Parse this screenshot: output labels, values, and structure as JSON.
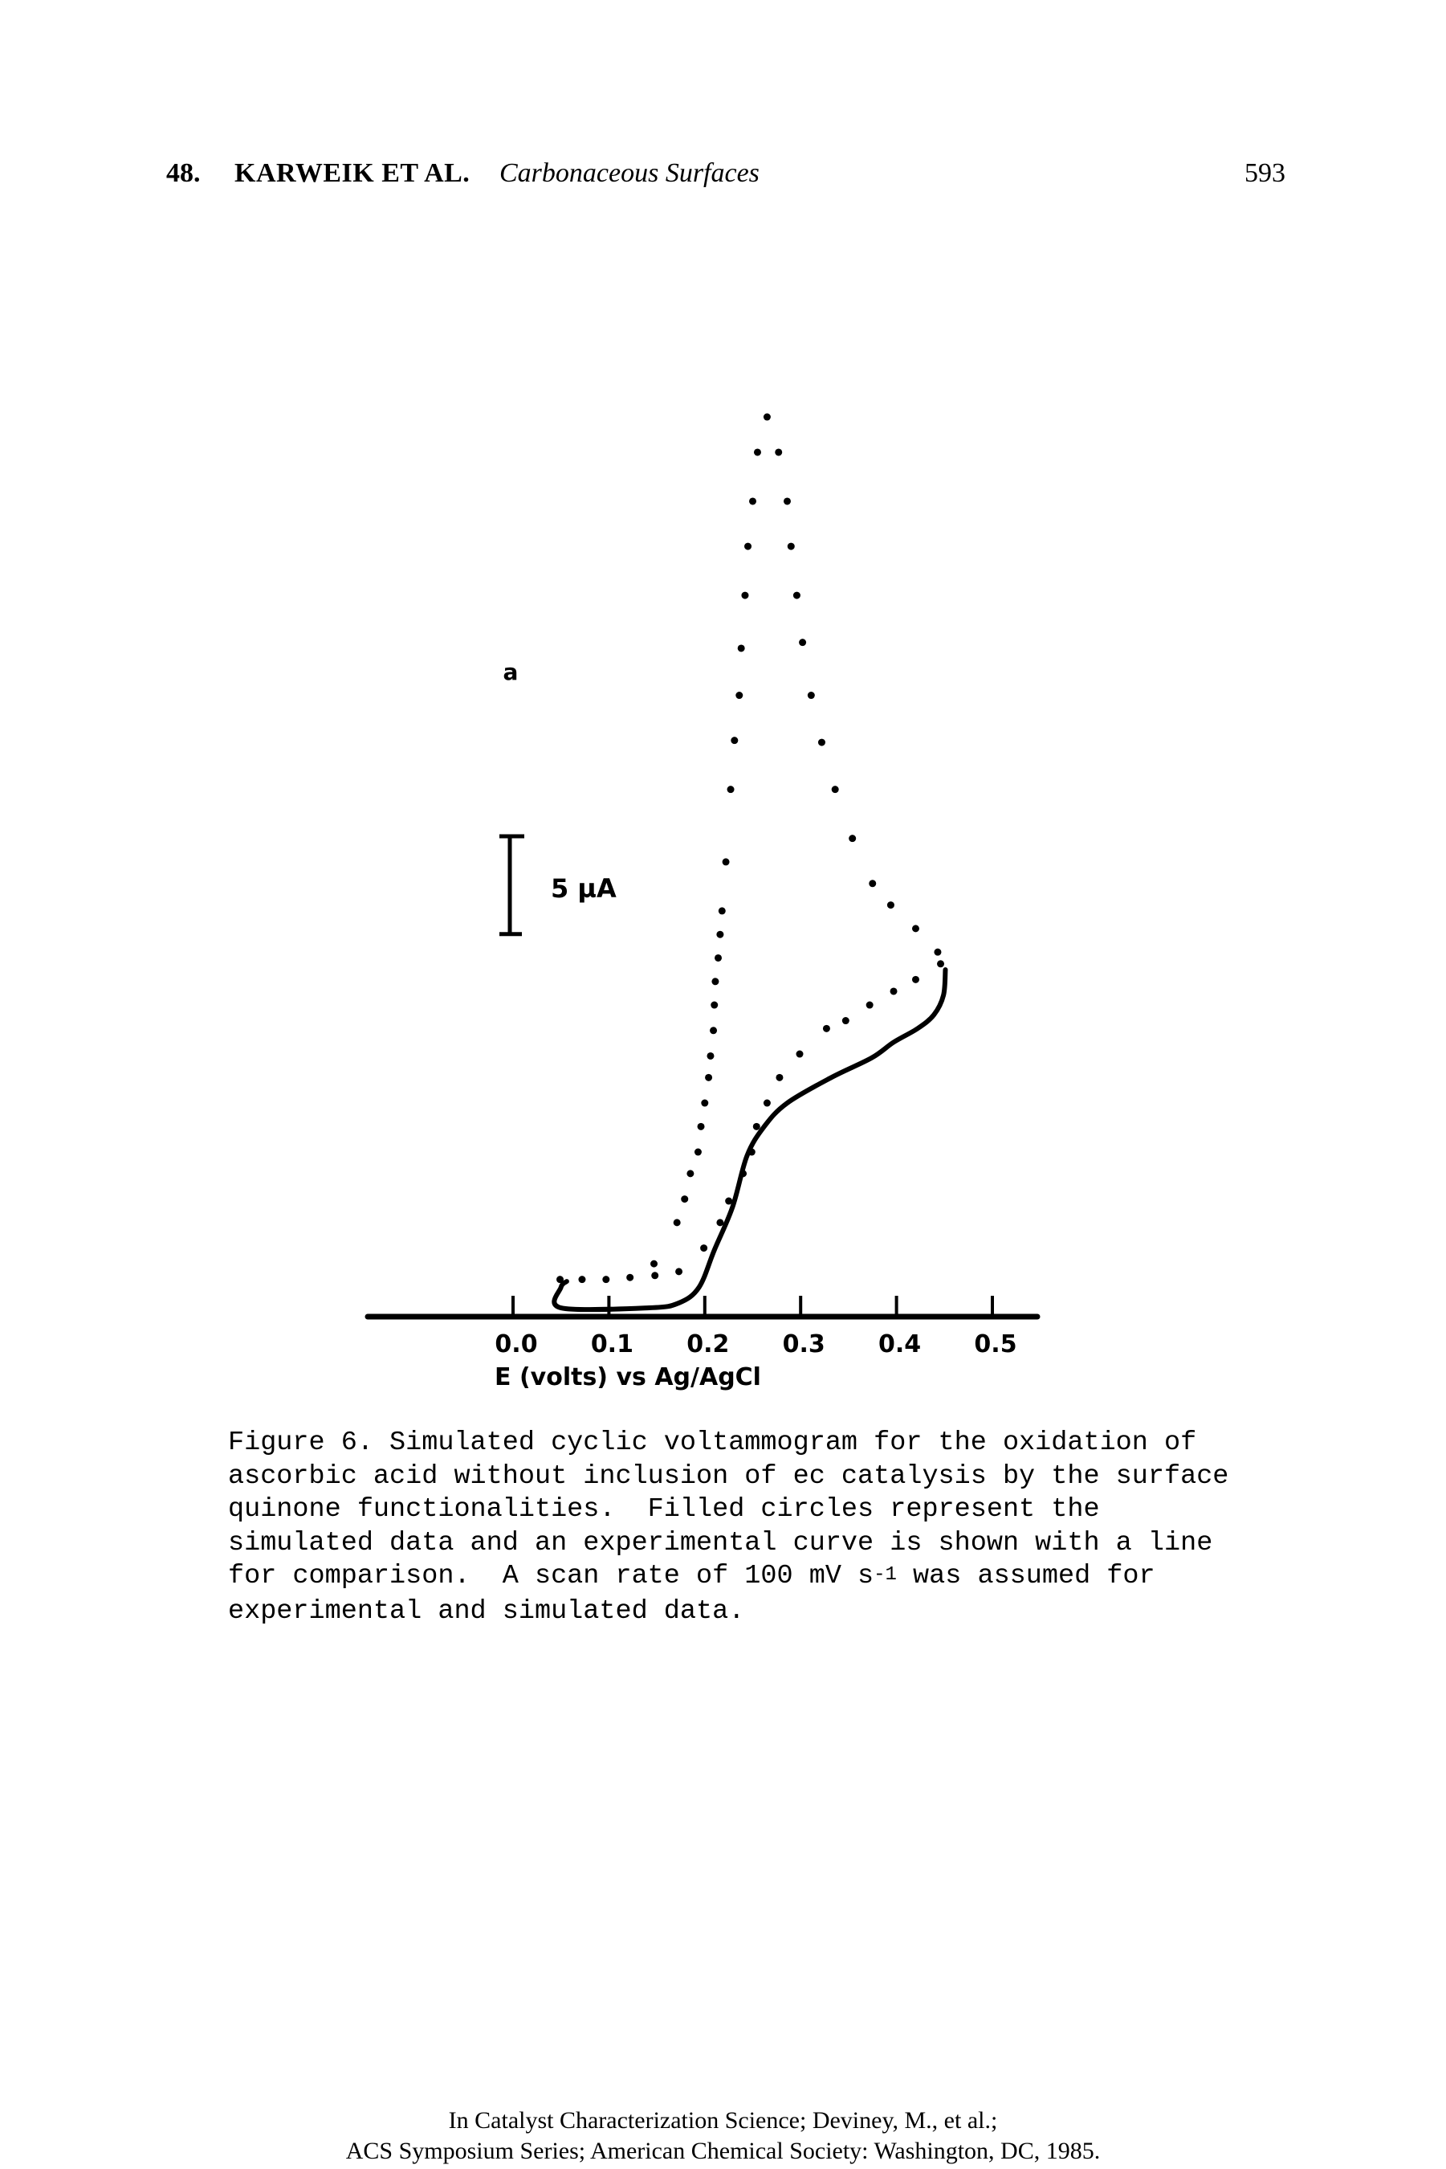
{
  "header": {
    "chapter_number": "48.",
    "authors": "KARWEIK ET AL.",
    "running_title": "Carbonaceous Surfaces",
    "page_number": "593"
  },
  "chart_data": {
    "type": "line",
    "panel_label": "a",
    "scale_bar_label": "5 µA",
    "scale_bar_value_uA": 5,
    "xlabel": "E (volts) vs Ag/AgCl",
    "ylabel": "",
    "xlim": [
      -0.15,
      0.55
    ],
    "ylim": [
      0,
      46
    ],
    "x_ticks": [
      0.0,
      0.1,
      0.2,
      0.3,
      0.4,
      0.5
    ],
    "x_tick_labels": [
      "0.0",
      "0.1",
      "0.2",
      "0.3",
      "0.4",
      "0.5"
    ],
    "grid": false,
    "legend": "none",
    "series": [
      {
        "name": "Simulated data",
        "style": "filled-circles",
        "points": [
          [
            0.049,
            1.9
          ],
          [
            0.072,
            1.9
          ],
          [
            0.097,
            1.9
          ],
          [
            0.122,
            2.0
          ],
          [
            0.147,
            2.7
          ],
          [
            0.171,
            4.8
          ],
          [
            0.179,
            6.0
          ],
          [
            0.185,
            7.3
          ],
          [
            0.193,
            8.4
          ],
          [
            0.196,
            9.7
          ],
          [
            0.2,
            10.9
          ],
          [
            0.204,
            12.2
          ],
          [
            0.206,
            13.3
          ],
          [
            0.209,
            14.6
          ],
          [
            0.21,
            15.9
          ],
          [
            0.211,
            17.1
          ],
          [
            0.214,
            18.3
          ],
          [
            0.216,
            19.5
          ],
          [
            0.218,
            20.7
          ],
          [
            0.222,
            23.2
          ],
          [
            0.227,
            26.9
          ],
          [
            0.231,
            29.4
          ],
          [
            0.236,
            31.7
          ],
          [
            0.238,
            34.1
          ],
          [
            0.242,
            36.8
          ],
          [
            0.245,
            39.3
          ],
          [
            0.25,
            41.6
          ],
          [
            0.255,
            44.1
          ],
          [
            0.265,
            45.9
          ],
          [
            0.277,
            44.1
          ],
          [
            0.286,
            41.6
          ],
          [
            0.29,
            39.3
          ],
          [
            0.296,
            36.8
          ],
          [
            0.302,
            34.4
          ],
          [
            0.311,
            31.7
          ],
          [
            0.322,
            29.3
          ],
          [
            0.336,
            26.9
          ],
          [
            0.354,
            24.4
          ],
          [
            0.375,
            22.1
          ],
          [
            0.394,
            21.0
          ],
          [
            0.42,
            19.8
          ],
          [
            0.443,
            18.6
          ],
          [
            0.446,
            18.0
          ],
          [
            0.42,
            17.2
          ],
          [
            0.397,
            16.6
          ],
          [
            0.372,
            15.9
          ],
          [
            0.347,
            15.1
          ],
          [
            0.327,
            14.7
          ],
          [
            0.299,
            13.4
          ],
          [
            0.278,
            12.2
          ],
          [
            0.265,
            10.9
          ],
          [
            0.254,
            9.7
          ],
          [
            0.249,
            8.4
          ],
          [
            0.24,
            7.3
          ],
          [
            0.225,
            5.9
          ],
          [
            0.216,
            4.8
          ],
          [
            0.199,
            3.5
          ],
          [
            0.173,
            2.3
          ],
          [
            0.148,
            2.1
          ]
        ]
      },
      {
        "name": "Experimental curve",
        "style": "solid-line",
        "points": [
          [
            0.056,
            1.8
          ],
          [
            0.05,
            1.5
          ],
          [
            0.05,
            0.45
          ],
          [
            0.142,
            0.45
          ],
          [
            0.173,
            0.7
          ],
          [
            0.194,
            1.5
          ],
          [
            0.21,
            3.4
          ],
          [
            0.229,
            5.6
          ],
          [
            0.244,
            8.2
          ],
          [
            0.262,
            9.7
          ],
          [
            0.286,
            10.9
          ],
          [
            0.332,
            12.2
          ],
          [
            0.374,
            13.2
          ],
          [
            0.397,
            14.0
          ],
          [
            0.422,
            14.7
          ],
          [
            0.439,
            15.4
          ],
          [
            0.449,
            16.4
          ],
          [
            0.451,
            17.7
          ]
        ]
      }
    ]
  },
  "caption": {
    "lines": [
      "Figure 6. Simulated cyclic voltammogram for the oxidation of",
      "ascorbic acid without inclusion of ec catalysis by the surface",
      "quinone functionalities.  Filled circles represent the",
      "simulated data and an experimental curve is shown with a line",
      "for comparison.  A scan rate of 100 mV s"
    ],
    "superscript": "-1",
    "line5_tail": " was assumed for",
    "last_line": "experimental and simulated data."
  },
  "footer": {
    "line1": "In Catalyst Characterization Science; Deviney, M., et al.;",
    "line2": "ACS Symposium Series; American Chemical Society: Washington, DC, 1985."
  }
}
